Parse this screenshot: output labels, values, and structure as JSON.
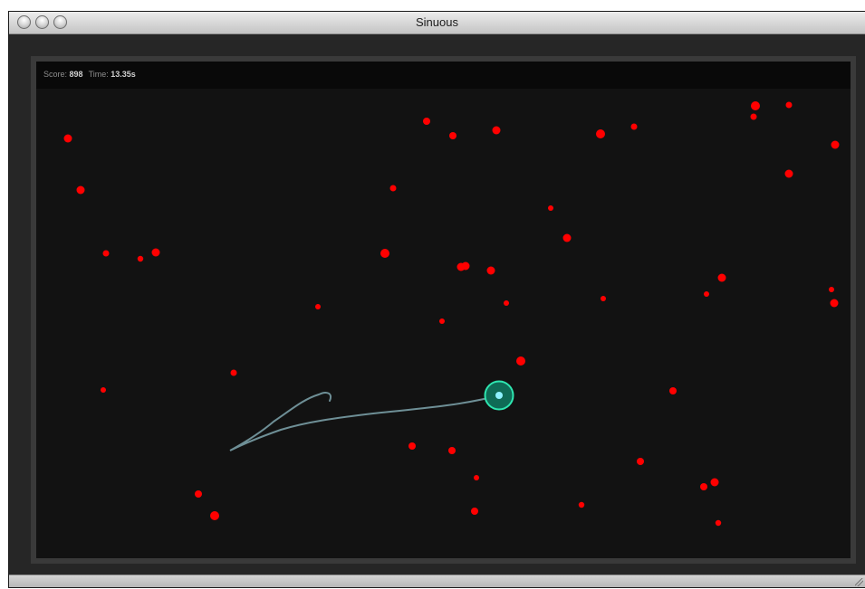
{
  "window": {
    "title": "Sinuous"
  },
  "hud": {
    "score_label": "Score:",
    "score_value": "898",
    "time_label": "Time:",
    "time_value": "13.35s"
  },
  "colors": {
    "enemy": "#ff0000",
    "enemy_dim": "#8c0000",
    "player_ring": "#2ee6b0",
    "player_core": "#8ef2ff",
    "trail": "#6e8f96",
    "stage_bg": "#121212",
    "hud_bg": "#090909"
  },
  "icons": {
    "close": "close-button-icon",
    "minimize": "minimize-button-icon",
    "zoom": "zoom-button-icon",
    "resize": "resize-grip-icon"
  }
}
